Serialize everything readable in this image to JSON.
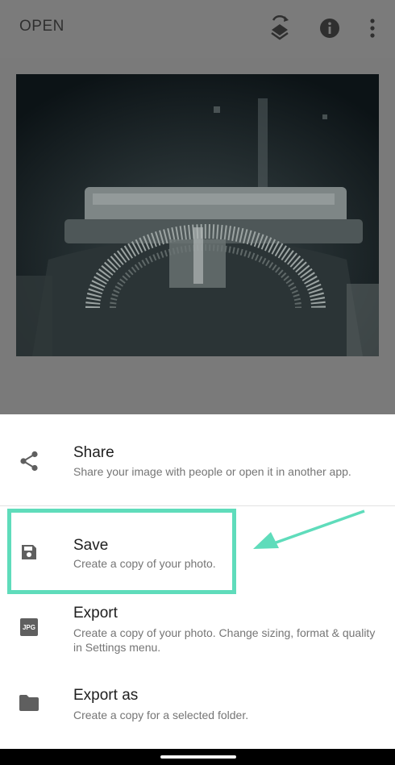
{
  "header": {
    "open_label": "OPEN"
  },
  "menu": {
    "share": {
      "title": "Share",
      "desc": "Share your image with people or open it in another app."
    },
    "save": {
      "title": "Save",
      "desc": "Create a copy of your photo."
    },
    "export": {
      "title": "Export",
      "desc": "Create a copy of your photo. Change sizing, format & quality in Settings menu.",
      "badge": "JPG"
    },
    "export_as": {
      "title": "Export as",
      "desc": "Create a copy for a selected folder."
    }
  },
  "colors": {
    "highlight": "#5fdcbb",
    "icon": "#5f5f5f"
  },
  "icons": [
    "share-icon",
    "save-icon",
    "jpg-icon",
    "folder-icon",
    "layers-icon",
    "info-icon",
    "more-vert-icon"
  ]
}
